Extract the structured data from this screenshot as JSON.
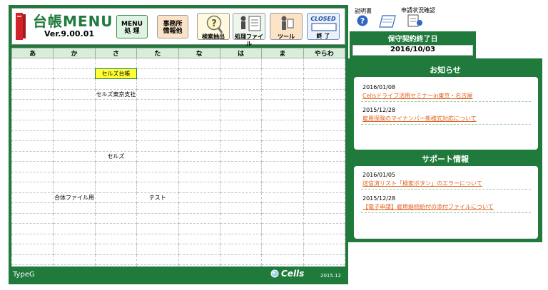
{
  "app": {
    "title": "台帳MENU",
    "version": "Ver.9.00.01"
  },
  "toolbar": {
    "menu": {
      "line1": "MENU",
      "line2": "処 理"
    },
    "office": {
      "line1": "事務所",
      "line2": "情報他"
    },
    "search": {
      "label": "検索抽出"
    },
    "done_file": {
      "label": "処理ファイル"
    },
    "tool": {
      "label": "ツール"
    },
    "closed": {
      "label": "CLOSED",
      "sub": "終 了"
    }
  },
  "grid": {
    "columns": [
      "あ",
      "か",
      "さ",
      "た",
      "な",
      "は",
      "ま",
      "やらわ"
    ],
    "entries": [
      {
        "row": 1,
        "col": 2,
        "text": "セルズ台帳",
        "selected": true
      },
      {
        "row": 3,
        "col": 2,
        "text": "セルズ東京支社"
      },
      {
        "row": 9,
        "col": 2,
        "text": "セルズ"
      },
      {
        "row": 13,
        "col": 1,
        "text": "合体ファイル用"
      },
      {
        "row": 13,
        "col": 3,
        "text": "テスト"
      }
    ]
  },
  "footer": {
    "type_label": "TypeG",
    "logo": "Cells",
    "year": "2015.12"
  },
  "top_icons": {
    "manual": "説明書",
    "status_check": "申請状況確認"
  },
  "contract": {
    "title": "保守契約終了日",
    "date": "2016/10/03"
  },
  "notices": {
    "title": "お知らせ",
    "items": [
      {
        "date": "2016/01/08",
        "text": "Cellsドライブ活用セミナーin東京・名古屋"
      },
      {
        "date": "2015/12/28",
        "text": "雇用保険のマイナンバー新様式対応について"
      }
    ]
  },
  "support": {
    "title": "サポート情報",
    "items": [
      {
        "date": "2016/01/05",
        "text": "送信済リスト「検索ボタン」のエラーについて"
      },
      {
        "date": "2015/12/28",
        "text": "【電子申請】雇用継続給付の添付ファイルについて"
      }
    ]
  },
  "colors": {
    "brand_green": "#1f7a3c",
    "link_orange": "#e0621f",
    "selected_cell": "#ffff33"
  }
}
